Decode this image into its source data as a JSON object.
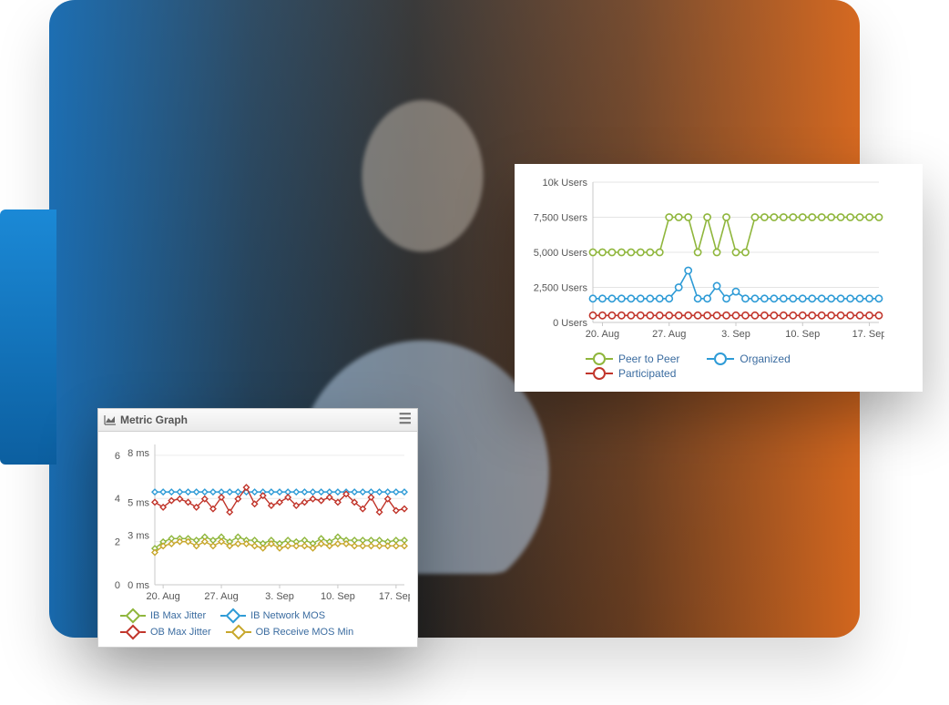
{
  "background": {
    "description": "Photo of a man at a desk with dual monitors, blue-to-orange gradient overlay",
    "accent_blue": "#1b89d6",
    "accent_orange": "#e87522"
  },
  "users_panel": {
    "legend": {
      "peer": {
        "label": "Peer to Peer",
        "color": "#8fb63c"
      },
      "org": {
        "label": "Organized",
        "color": "#2e9bd6"
      },
      "part": {
        "label": "Participated",
        "color": "#c1352b"
      }
    }
  },
  "metric_panel": {
    "title": "Metric Graph",
    "legend": {
      "ib_jitter": {
        "label": "IB Max Jitter",
        "color": "#8fb63c"
      },
      "ib_mos": {
        "label": "IB Network MOS",
        "color": "#2e9bd6"
      },
      "ob_jitter": {
        "label": "OB Max Jitter",
        "color": "#c1352b"
      },
      "ob_mos_min": {
        "label": "OB Receive MOS Min",
        "color": "#c7a72c"
      }
    }
  },
  "chart_data": [
    {
      "id": "users",
      "type": "line",
      "title": "",
      "xlabel": "",
      "ylabel": "",
      "ylim": [
        0,
        10000
      ],
      "y_tick_labels": [
        "0 Users",
        "2,500 Users",
        "5,000 Users",
        "7,500 Users",
        "10k Users"
      ],
      "y_ticks": [
        0,
        2500,
        5000,
        7500,
        10000
      ],
      "x_tick_labels": [
        "20. Aug",
        "27. Aug",
        "3. Sep",
        "10. Sep",
        "17. Sep"
      ],
      "x_tick_idx": [
        1,
        8,
        15,
        22,
        29
      ],
      "n_points": 31,
      "series": [
        {
          "name": "Peer to Peer",
          "color": "#8fb63c",
          "values": [
            5000,
            5000,
            5000,
            5000,
            5000,
            5000,
            5000,
            5000,
            7500,
            7500,
            7500,
            5000,
            7500,
            5000,
            7500,
            5000,
            5000,
            7500,
            7500,
            7500,
            7500,
            7500,
            7500,
            7500,
            7500,
            7500,
            7500,
            7500,
            7500,
            7500,
            7500
          ]
        },
        {
          "name": "Organized",
          "color": "#2e9bd6",
          "values": [
            1700,
            1700,
            1700,
            1700,
            1700,
            1700,
            1700,
            1700,
            1700,
            2500,
            3700,
            1700,
            1700,
            2600,
            1700,
            2200,
            1700,
            1700,
            1700,
            1700,
            1700,
            1700,
            1700,
            1700,
            1700,
            1700,
            1700,
            1700,
            1700,
            1700,
            1700
          ]
        },
        {
          "name": "Participated",
          "color": "#c1352b",
          "values": [
            500,
            500,
            500,
            500,
            500,
            500,
            500,
            500,
            500,
            500,
            500,
            500,
            500,
            500,
            500,
            500,
            500,
            500,
            500,
            500,
            500,
            500,
            500,
            500,
            500,
            500,
            500,
            500,
            500,
            500,
            500
          ]
        }
      ],
      "marker": "open-circle"
    },
    {
      "id": "metric",
      "type": "line",
      "title": "Metric Graph",
      "left_axis": {
        "ticks": [
          0,
          2,
          4,
          6
        ],
        "labels": [
          "0",
          "2",
          "4",
          "6"
        ],
        "lim": [
          0,
          6.5
        ]
      },
      "right_axis": {
        "ticks": [
          0,
          3,
          5,
          8
        ],
        "labels": [
          "0 ms",
          "3 ms",
          "5 ms",
          "8 ms"
        ],
        "lim": [
          0,
          8.5
        ]
      },
      "x_tick_labels": [
        "20. Aug",
        "27. Aug",
        "3. Sep",
        "10. Sep",
        "17. Sep"
      ],
      "x_tick_idx": [
        1,
        8,
        15,
        22,
        29
      ],
      "n_points": 31,
      "series": [
        {
          "name": "IB Network MOS",
          "axis": "left",
          "color": "#2e9bd6",
          "values": [
            4.3,
            4.3,
            4.3,
            4.3,
            4.3,
            4.3,
            4.3,
            4.3,
            4.3,
            4.3,
            4.3,
            4.3,
            4.3,
            4.3,
            4.3,
            4.3,
            4.3,
            4.3,
            4.3,
            4.3,
            4.3,
            4.3,
            4.3,
            4.3,
            4.3,
            4.3,
            4.3,
            4.3,
            4.3,
            4.3,
            4.3
          ]
        },
        {
          "name": "OB Max Jitter",
          "axis": "right",
          "color": "#c1352b",
          "values": [
            5.0,
            4.7,
            5.1,
            5.2,
            5.0,
            4.7,
            5.2,
            4.6,
            5.3,
            4.4,
            5.2,
            5.9,
            4.9,
            5.4,
            4.8,
            5.0,
            5.3,
            4.8,
            5.0,
            5.2,
            5.1,
            5.3,
            5.0,
            5.5,
            5.0,
            4.6,
            5.3,
            4.4,
            5.2,
            4.5,
            4.6
          ]
        },
        {
          "name": "IB Max Jitter",
          "axis": "right",
          "color": "#8fb63c",
          "values": [
            2.2,
            2.6,
            2.8,
            2.8,
            2.8,
            2.7,
            2.9,
            2.7,
            2.9,
            2.6,
            2.9,
            2.7,
            2.7,
            2.5,
            2.7,
            2.5,
            2.7,
            2.6,
            2.7,
            2.5,
            2.8,
            2.6,
            2.9,
            2.7,
            2.7,
            2.7,
            2.7,
            2.7,
            2.6,
            2.7,
            2.7
          ]
        },
        {
          "name": "OB Receive MOS Min",
          "axis": "left",
          "color": "#c7a72c",
          "values": [
            1.5,
            1.8,
            1.9,
            2.0,
            2.0,
            1.8,
            2.0,
            1.8,
            2.0,
            1.8,
            1.9,
            1.9,
            1.8,
            1.7,
            1.9,
            1.7,
            1.8,
            1.8,
            1.8,
            1.7,
            1.9,
            1.8,
            1.9,
            1.9,
            1.8,
            1.8,
            1.8,
            1.8,
            1.8,
            1.8,
            1.8
          ]
        }
      ],
      "marker": "diamond"
    }
  ]
}
